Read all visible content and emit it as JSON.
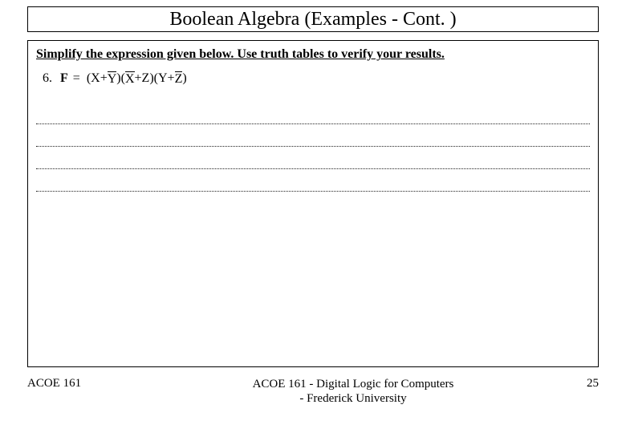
{
  "title": "Boolean Algebra (Examples - Cont. )",
  "instruction": "Simplify the expression given below. Use truth tables to verify your results.",
  "equation": {
    "number": "6.",
    "lhs": "F",
    "eq": "=",
    "groups": [
      {
        "a": "X",
        "a_bar": false,
        "b": "Y",
        "b_bar": true
      },
      {
        "a": "X",
        "a_bar": true,
        "b": "Z",
        "b_bar": false
      },
      {
        "a": "Y",
        "a_bar": false,
        "b": "Z",
        "b_bar": true
      }
    ],
    "plus": "+"
  },
  "rule_count": 4,
  "footer": {
    "left": "ACOE 161",
    "center_line1": "ACOE 161 - Digital Logic for Computers",
    "center_line2": "- Frederick University",
    "page": "25"
  }
}
